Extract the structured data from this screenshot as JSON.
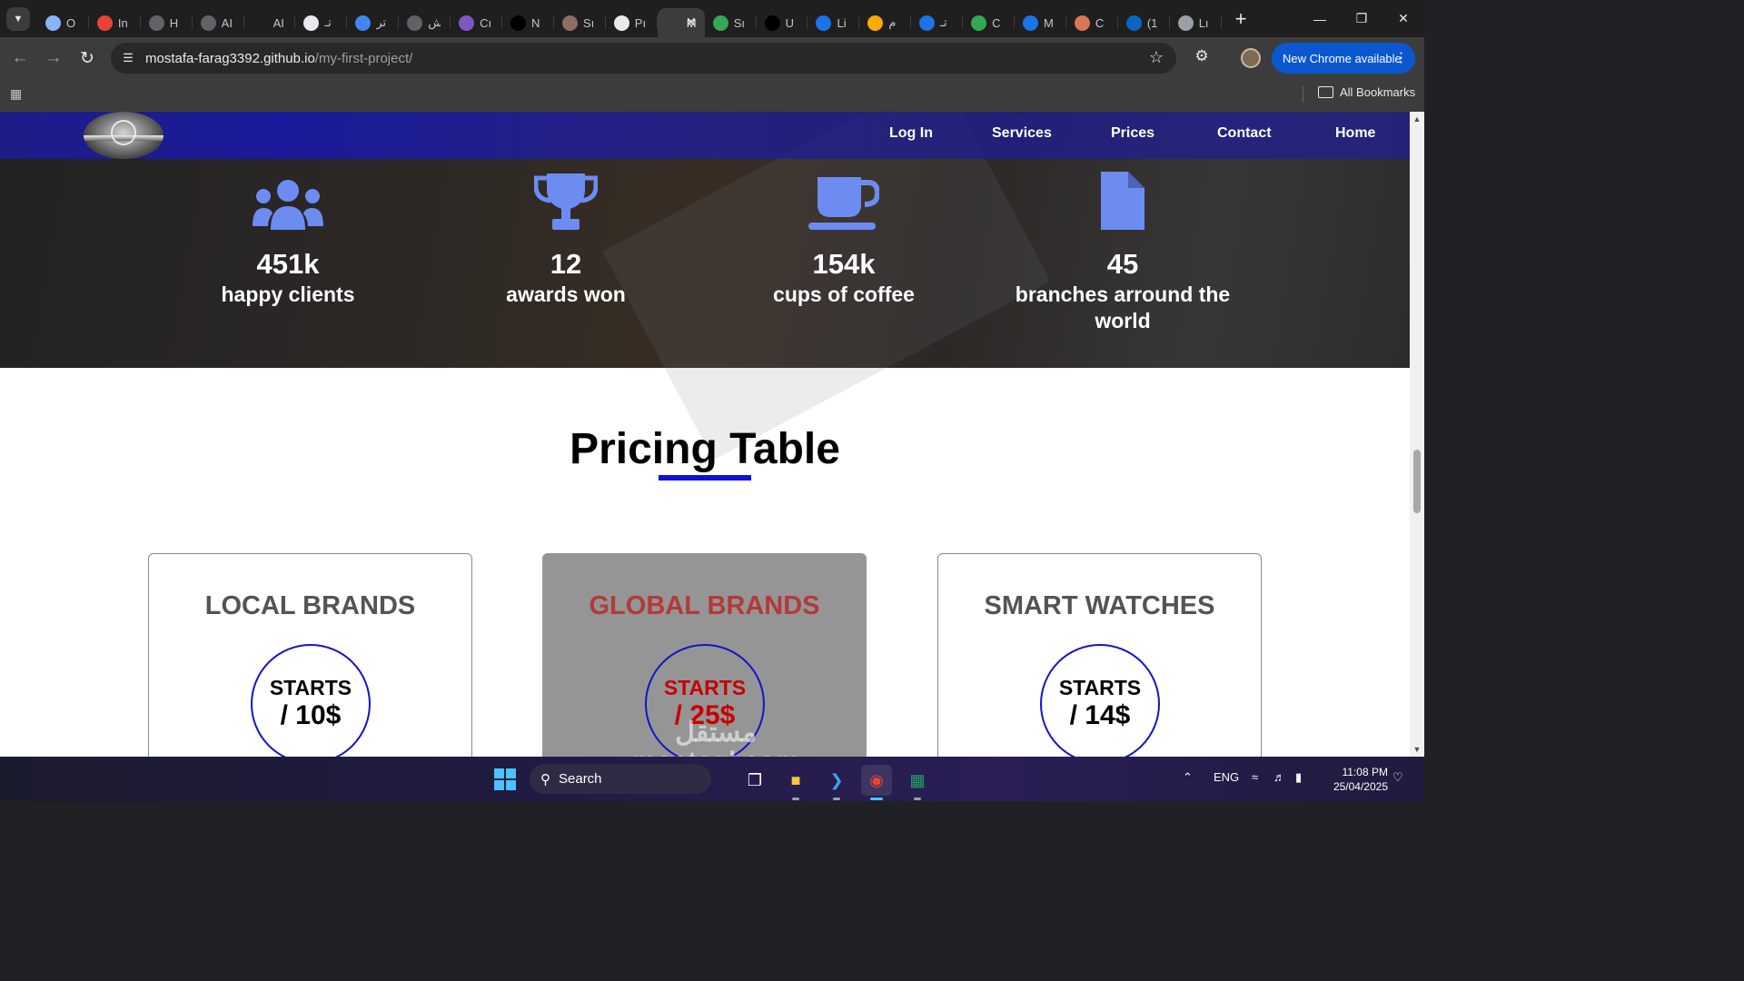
{
  "browser": {
    "tabs": [
      {
        "label": "O",
        "favicon_color": "#8ab4f8"
      },
      {
        "label": "In",
        "favicon_color": "#ea4335"
      },
      {
        "label": "H",
        "favicon_color": "#5f6368"
      },
      {
        "label": "AI",
        "favicon_color": "#5f6368"
      },
      {
        "label": "AI",
        "favicon_color": "#1f1f1f"
      },
      {
        "label": "تـ",
        "favicon_color": "#e8eaed"
      },
      {
        "label": "تر",
        "favicon_color": "#4285f4"
      },
      {
        "label": "ش",
        "favicon_color": "#5f6368"
      },
      {
        "label": "Cı",
        "favicon_color": "#7e57c2"
      },
      {
        "label": "N",
        "favicon_color": "#000000"
      },
      {
        "label": "Sı",
        "favicon_color": "#8d6e63"
      },
      {
        "label": "Pı",
        "favicon_color": "#e8eaed"
      },
      {
        "label": "M",
        "favicon_color": "#3c3c3c"
      },
      {
        "label": "Sı",
        "favicon_color": "#34a853"
      },
      {
        "label": "U",
        "favicon_color": "#000000"
      },
      {
        "label": "Li",
        "favicon_color": "#1a73e8"
      },
      {
        "label": "م",
        "favicon_color": "#f9ab00"
      },
      {
        "label": "تـ",
        "favicon_color": "#1a73e8"
      },
      {
        "label": "C",
        "favicon_color": "#34a853"
      },
      {
        "label": "M",
        "favicon_color": "#1a73e8"
      },
      {
        "label": "C",
        "favicon_color": "#d97757"
      },
      {
        "label": "(1",
        "favicon_color": "#0a66c2"
      },
      {
        "label": "Lı",
        "favicon_color": "#9aa0a6"
      }
    ],
    "url_host": "mostafa-farag3392.github.io",
    "url_path": "/my-first-project/",
    "update_label": "New Chrome available",
    "all_bookmarks_label": "All Bookmarks"
  },
  "site": {
    "nav": {
      "login": "Log In",
      "services": "Services",
      "prices": "Prices",
      "contact": "Contact",
      "home": "Home"
    },
    "accent_color": "#1a1a9a",
    "icon_color": "#6d8cf2",
    "stats": [
      {
        "icon": "users-icon",
        "value": "451k",
        "label": "happy clients"
      },
      {
        "icon": "trophy-icon",
        "value": "12",
        "label": "awards won"
      },
      {
        "icon": "coffee-cup-icon",
        "value": "154k",
        "label": "cups of coffee"
      },
      {
        "icon": "document-icon",
        "value": "45",
        "label": "branches arround the world"
      }
    ],
    "pricing": {
      "title": "Pricing Table",
      "plans": [
        {
          "name": "LOCAL BRANDS",
          "lead": "STARTS",
          "price": "/ 10$"
        },
        {
          "name": "GLOBAL BRANDS",
          "lead": "STARTS",
          "price": "/ 25$"
        },
        {
          "name": "SMART WATCHES",
          "lead": "STARTS",
          "price": "/ 14$"
        }
      ]
    },
    "watermark": "مستقل mostaql.com"
  },
  "taskbar": {
    "search_label": "Search",
    "language": "ENG",
    "time": "11:08 PM",
    "date": "25/04/2025"
  }
}
